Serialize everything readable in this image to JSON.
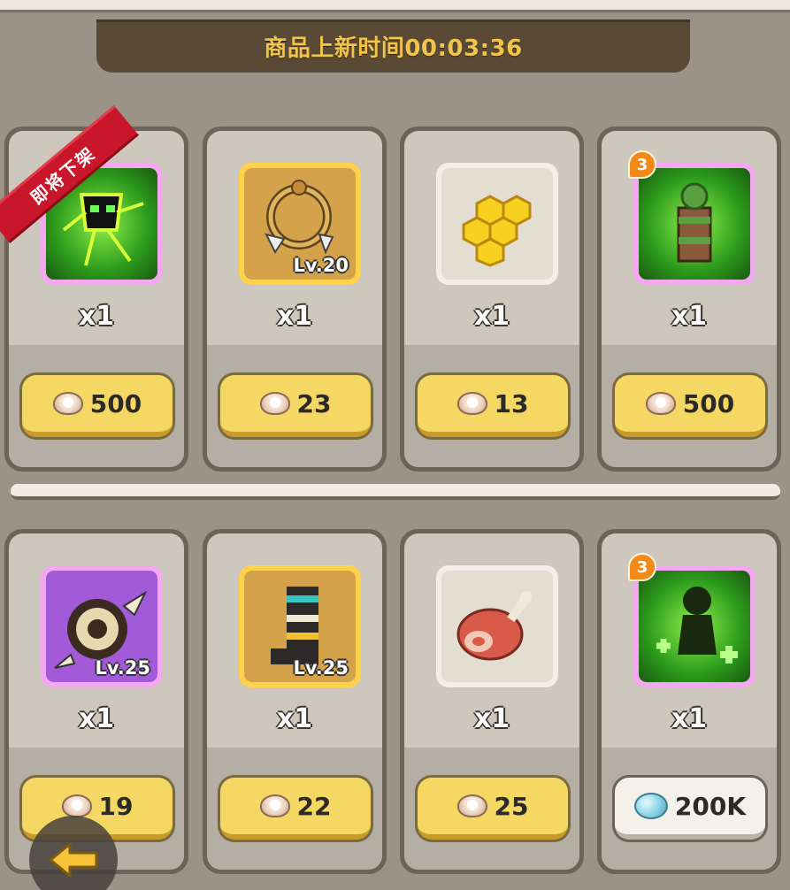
{
  "header": {
    "timer_text": "商品上新时间00:03:36"
  },
  "ribbon": {
    "label": "即将下架"
  },
  "items": [
    {
      "name": "green-silhouette-skill",
      "frame": "purple",
      "bg": "green",
      "level": "",
      "qty": "x1",
      "price": "500",
      "currency": "pearl-icon",
      "badge": ""
    },
    {
      "name": "claw-ring",
      "frame": "gold",
      "bg": "gold",
      "level": "Lv.20",
      "qty": "x1",
      "price": "23",
      "currency": "pearl-icon",
      "badge": ""
    },
    {
      "name": "honeycomb",
      "frame": "white",
      "bg": "white",
      "level": "",
      "qty": "x1",
      "price": "13",
      "currency": "pearl-icon",
      "badge": ""
    },
    {
      "name": "forest-totem-skill",
      "frame": "purple",
      "bg": "green",
      "level": "",
      "qty": "x1",
      "price": "500",
      "currency": "pearl-icon",
      "badge": "3"
    },
    {
      "name": "horned-ring",
      "frame": "purple",
      "bg": "purple",
      "level": "Lv.25",
      "qty": "x1",
      "price": "19",
      "currency": "pearl-icon",
      "badge": ""
    },
    {
      "name": "striped-boots",
      "frame": "gold",
      "bg": "gold",
      "level": "Lv.25",
      "qty": "x1",
      "price": "22",
      "currency": "pearl-icon",
      "badge": ""
    },
    {
      "name": "meat-drumstick",
      "frame": "white",
      "bg": "white",
      "level": "",
      "qty": "x1",
      "price": "25",
      "currency": "pearl-icon",
      "badge": ""
    },
    {
      "name": "heal-silhouette-skill",
      "frame": "purple",
      "bg": "green",
      "level": "",
      "qty": "x1",
      "price": "200K",
      "currency": "gem-icon",
      "badge": "3"
    }
  ]
}
